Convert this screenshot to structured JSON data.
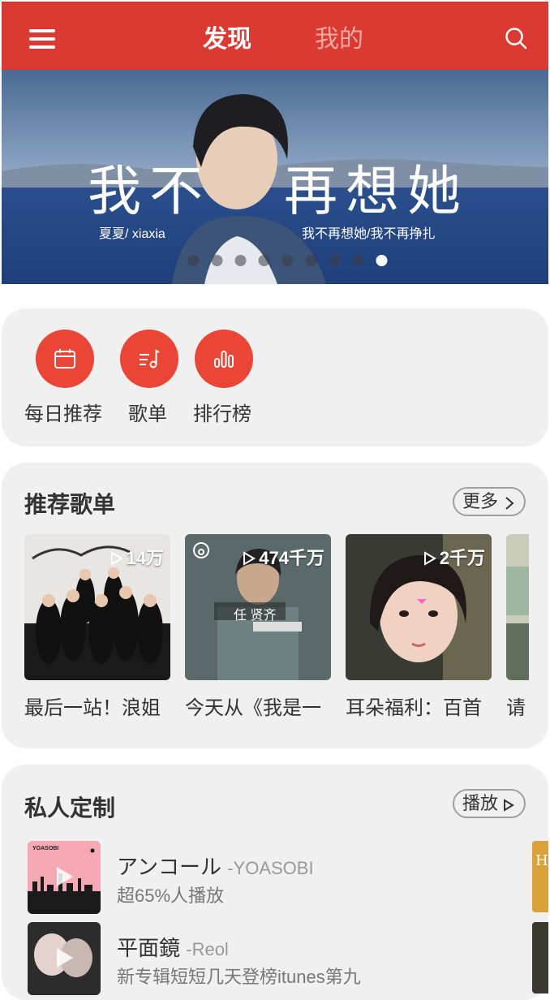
{
  "header": {
    "tab_discover": "发现",
    "tab_mine": "我的",
    "accent_color": "#db3a33"
  },
  "banner": {
    "title_left": "我不",
    "title_right": "再想她",
    "artist_line": "夏夏/ xiaxia",
    "song_line": "我不再想她/我不再挣扎",
    "dot_count": 10,
    "active_dot": 8
  },
  "quick_actions": [
    {
      "label": "每日推荐",
      "icon": "calendar-icon"
    },
    {
      "label": "歌单",
      "icon": "playlist-icon"
    },
    {
      "label": "排行榜",
      "icon": "chart-icon"
    }
  ],
  "recommend": {
    "title": "推荐歌单",
    "more_label": "更多",
    "playlists": [
      {
        "count": "14万",
        "title": "最后一站！浪姐"
      },
      {
        "count": "474千万",
        "title": "今天从《我是一"
      },
      {
        "count": "2千万",
        "title": "耳朵福利：百首"
      },
      {
        "count": "",
        "title": "请"
      }
    ]
  },
  "custom": {
    "title": "私人定制",
    "play_label": "播放",
    "songs": [
      {
        "name": "アンコール",
        "artist": "-YOASOBI",
        "desc": "超65%人播放",
        "cover_text": "YOASOBI"
      },
      {
        "name": "平面鏡",
        "artist": "-Reol",
        "desc": "新专辑短短几天登榜itunes第九"
      }
    ]
  }
}
